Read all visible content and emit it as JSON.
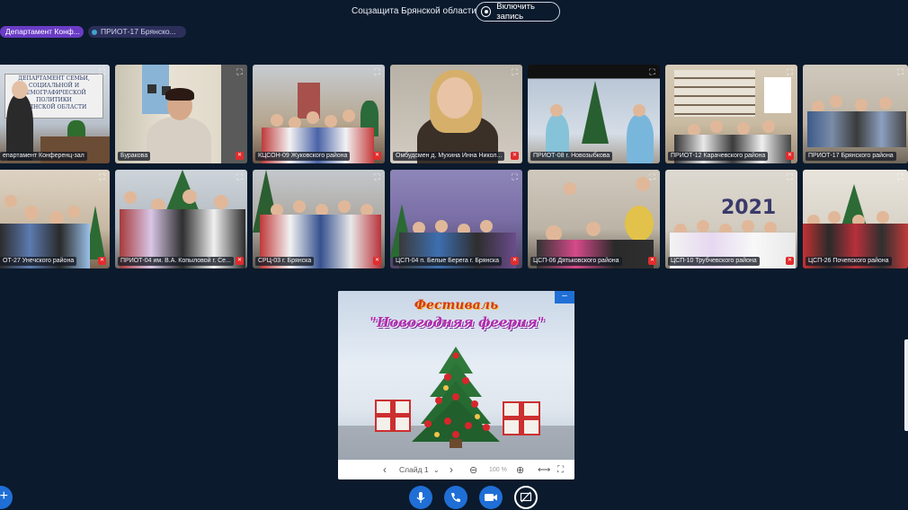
{
  "header": {
    "title": "Соцзащита Брянской области",
    "record_label": "Включить запись"
  },
  "presenters": [
    "Департамент Конф...",
    "ПРИОТ-17 Брянско..."
  ],
  "tiles": [
    {
      "name": "епартамент Конференц-зал"
    },
    {
      "name": "Буракова"
    },
    {
      "name": "КЦСОН-09 Жуковского района"
    },
    {
      "name": "Омбудсмен д. Мухина Инна Никол..."
    },
    {
      "name": "ПРИОТ-08 г. Новозыбкова"
    },
    {
      "name": "ПРИОТ-12 Карачевского района"
    },
    {
      "name": "ПРИОТ-17 Брянского района"
    },
    {
      "name": "ОТ-27 Унечского района"
    },
    {
      "name": "ПРИОТ-04 им. В.А. Копыловой г. Се..."
    },
    {
      "name": "СРЦ-03 г. Брянска"
    },
    {
      "name": "ЦСП-04 п. Белые Берега г. Брянска"
    },
    {
      "name": "ЦСП-06 Дятьковского района"
    },
    {
      "name": "ЦСП-10 Трубчевского района"
    },
    {
      "name": "ЦСП-26 Почепского района"
    }
  ],
  "slide": {
    "title": "Фестиваль",
    "subtitle": "\"Новогодняя феерия\"",
    "slide_label": "Слайд 1",
    "zoom": "100 %"
  },
  "controls": {
    "mic": "microphone-icon",
    "phone": "phone-icon",
    "camera": "camera-icon",
    "share": "screen-share-off-icon"
  }
}
